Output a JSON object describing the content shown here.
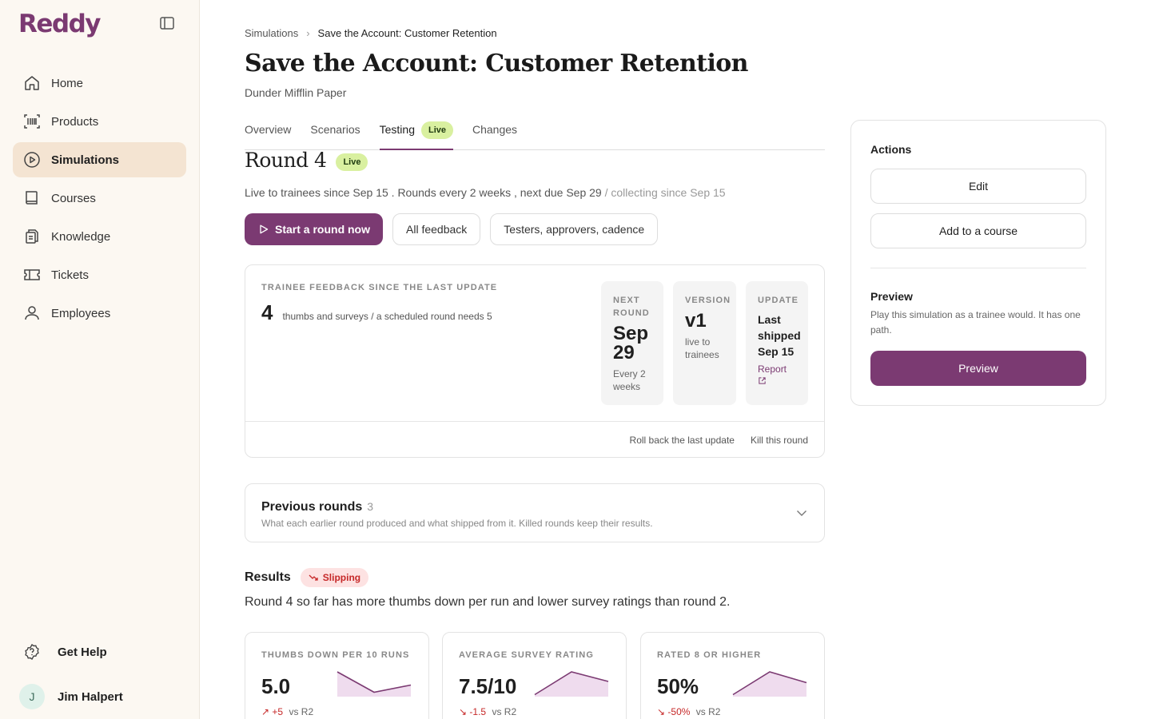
{
  "app": {
    "logo": "Reddy"
  },
  "sidebar": {
    "items": [
      {
        "label": "Home",
        "icon": "home-icon"
      },
      {
        "label": "Products",
        "icon": "barcode-icon"
      },
      {
        "label": "Simulations",
        "icon": "play-circle-icon",
        "active": true
      },
      {
        "label": "Courses",
        "icon": "book-icon"
      },
      {
        "label": "Knowledge",
        "icon": "documents-icon"
      },
      {
        "label": "Tickets",
        "icon": "ticket-icon"
      },
      {
        "label": "Employees",
        "icon": "user-icon"
      }
    ],
    "help_label": "Get Help",
    "user": {
      "initial": "J",
      "name": "Jim Halpert"
    }
  },
  "breadcrumb": {
    "parent": "Simulations",
    "current": "Save the Account: Customer Retention"
  },
  "page": {
    "title": "Save the Account: Customer Retention",
    "subtitle": "Dunder Mifflin Paper"
  },
  "tabs": [
    {
      "label": "Overview"
    },
    {
      "label": "Scenarios"
    },
    {
      "label": "Testing",
      "badge": "Live",
      "active": true
    },
    {
      "label": "Changes"
    }
  ],
  "round": {
    "title": "Round 4",
    "badge": "Live",
    "info": "Live to trainees since Sep 15 . Rounds every 2 weeks , next due Sep 29",
    "info_muted": "/ collecting since Sep 15",
    "buttons": {
      "start": "Start a round now",
      "feedback": "All feedback",
      "settings": "Testers, approvers, cadence"
    }
  },
  "feedback": {
    "label": "Trainee feedback since the last update",
    "count": "4",
    "count_desc": "thumbs and surveys / a scheduled round needs 5",
    "next_round": {
      "label_line1": "Next",
      "label_line2": "round",
      "value_line1": "Sep",
      "value_line2": "29",
      "sub_line1": "Every 2",
      "sub_line2": "weeks"
    },
    "version": {
      "label": "Version",
      "value": "v1",
      "sub_line1": "live to",
      "sub_line2": "trainees"
    },
    "update": {
      "label": "Update",
      "line1": "Last",
      "line2": "shipped",
      "line3": "Sep 15",
      "link": "Report"
    },
    "footer": {
      "rollback": "Roll back the last update",
      "kill": "Kill this round"
    }
  },
  "previous": {
    "title": "Previous rounds",
    "count": "3",
    "desc": "What each earlier round produced and what shipped from it. Killed rounds keep their results."
  },
  "results": {
    "title": "Results",
    "badge": "Slipping",
    "summary": "Round 4 so far has more thumbs down per run and lower survey ratings than round 2.",
    "metrics": [
      {
        "label": "Thumbs down per 10 runs",
        "value": "5.0",
        "delta": "+5",
        "vs": "vs R2",
        "trend": [
          1,
          0.15,
          0.45
        ]
      },
      {
        "label": "Average survey rating",
        "value": "7.5/10",
        "delta": "-1.5",
        "vs": "vs R2",
        "trend": [
          0.05,
          1,
          0.6
        ]
      },
      {
        "label": "Rated 8 or higher",
        "value": "50%",
        "delta": "-50%",
        "vs": "vs R2",
        "trend": [
          0.05,
          1,
          0.55
        ]
      }
    ]
  },
  "actions": {
    "title": "Actions",
    "edit": "Edit",
    "add_course": "Add to a course",
    "preview_title": "Preview",
    "preview_desc": "Play this simulation as a trainee would. It has one path.",
    "preview_button": "Preview"
  },
  "colors": {
    "brand": "#7b3a72",
    "live": "#d9f0a0",
    "danger": "#c62828",
    "sidebar_bg": "#fcf8f2",
    "active_nav": "#f4e4d2"
  }
}
